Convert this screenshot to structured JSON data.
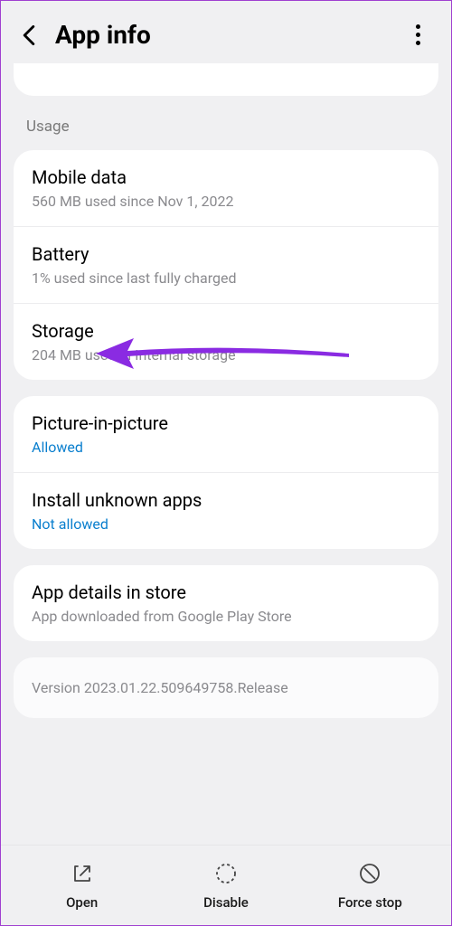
{
  "header": {
    "title": "App info"
  },
  "sections": {
    "usage_label": "Usage",
    "mobile_data": {
      "title": "Mobile data",
      "sub": "560 MB used since Nov 1, 2022"
    },
    "battery": {
      "title": "Battery",
      "sub": "1% used since last fully charged"
    },
    "storage": {
      "title": "Storage",
      "sub": "204 MB used in Internal storage"
    },
    "pip": {
      "title": "Picture-in-picture",
      "sub": "Allowed"
    },
    "install_unknown": {
      "title": "Install unknown apps",
      "sub": "Not allowed"
    },
    "app_details": {
      "title": "App details in store",
      "sub": "App downloaded from Google Play Store"
    },
    "version": "Version 2023.01.22.509649758.Release"
  },
  "bottom": {
    "open": "Open",
    "disable": "Disable",
    "force_stop": "Force stop"
  },
  "annotation_color": "#8a2be2"
}
